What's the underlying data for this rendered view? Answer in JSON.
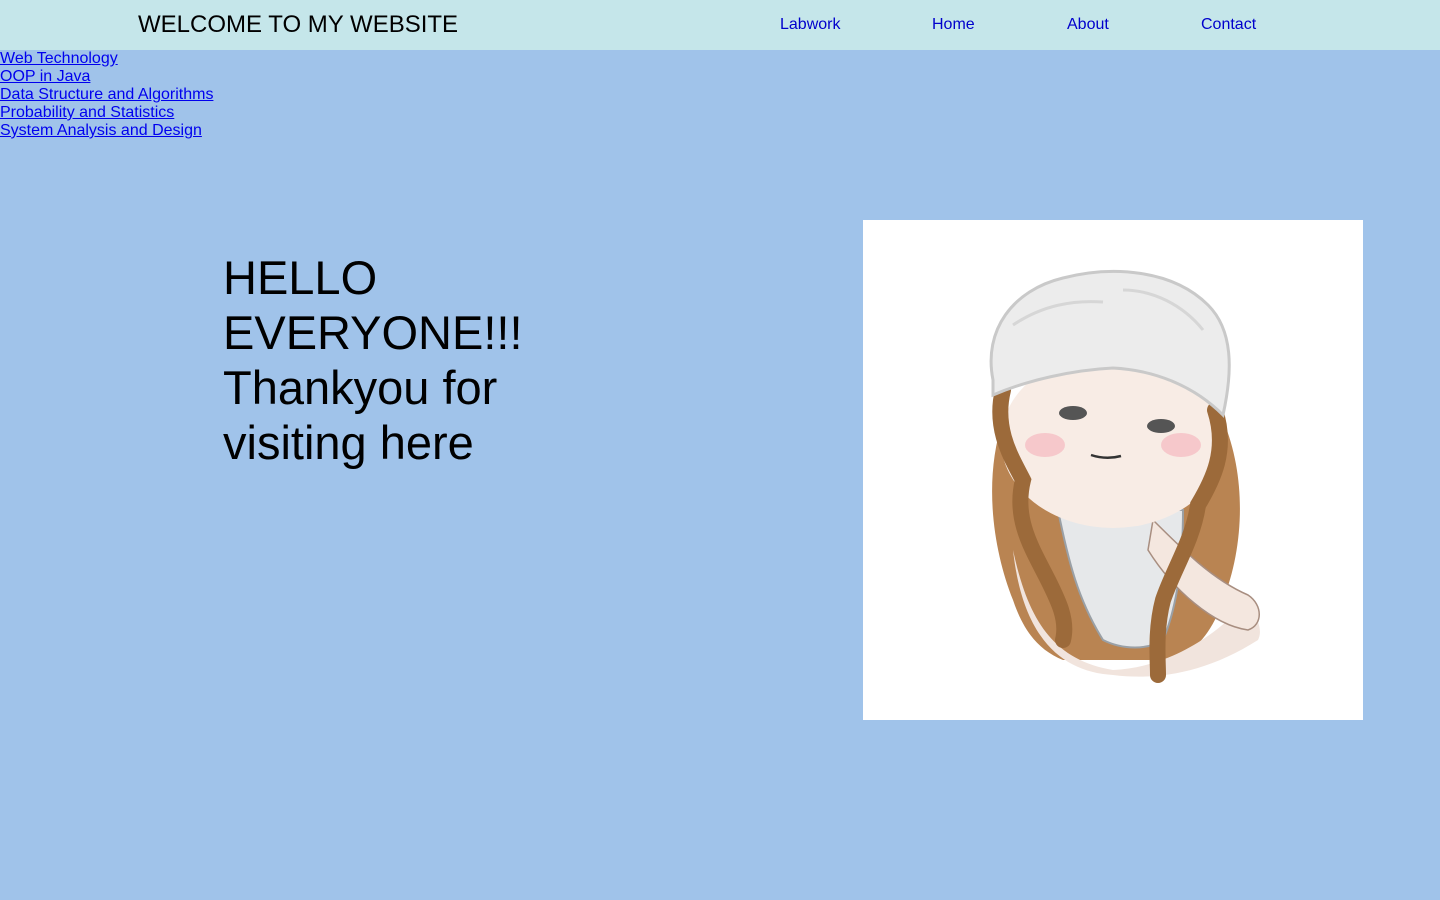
{
  "header": {
    "title": "WELCOME TO MY WEBSITE",
    "nav": [
      "Labwork",
      "Home",
      "About",
      "Contact"
    ]
  },
  "sidebar": {
    "courses": [
      "Web Technology",
      "OOP in Java",
      "Data Structure and Algorithms",
      "Probability and Statistics",
      "System Analysis and Design"
    ]
  },
  "main": {
    "greeting_lines": [
      "HELLO",
      "EVERYONE!!!",
      "Thankyou for",
      "visiting here"
    ]
  },
  "colors": {
    "page_background": "#a0c3ea",
    "header_background": "#c5e6ea",
    "nav_link": "#0000cc",
    "course_link": "#0000ee"
  },
  "icons": {
    "profile_picture": "girl-with-fur-hat-illustration"
  }
}
